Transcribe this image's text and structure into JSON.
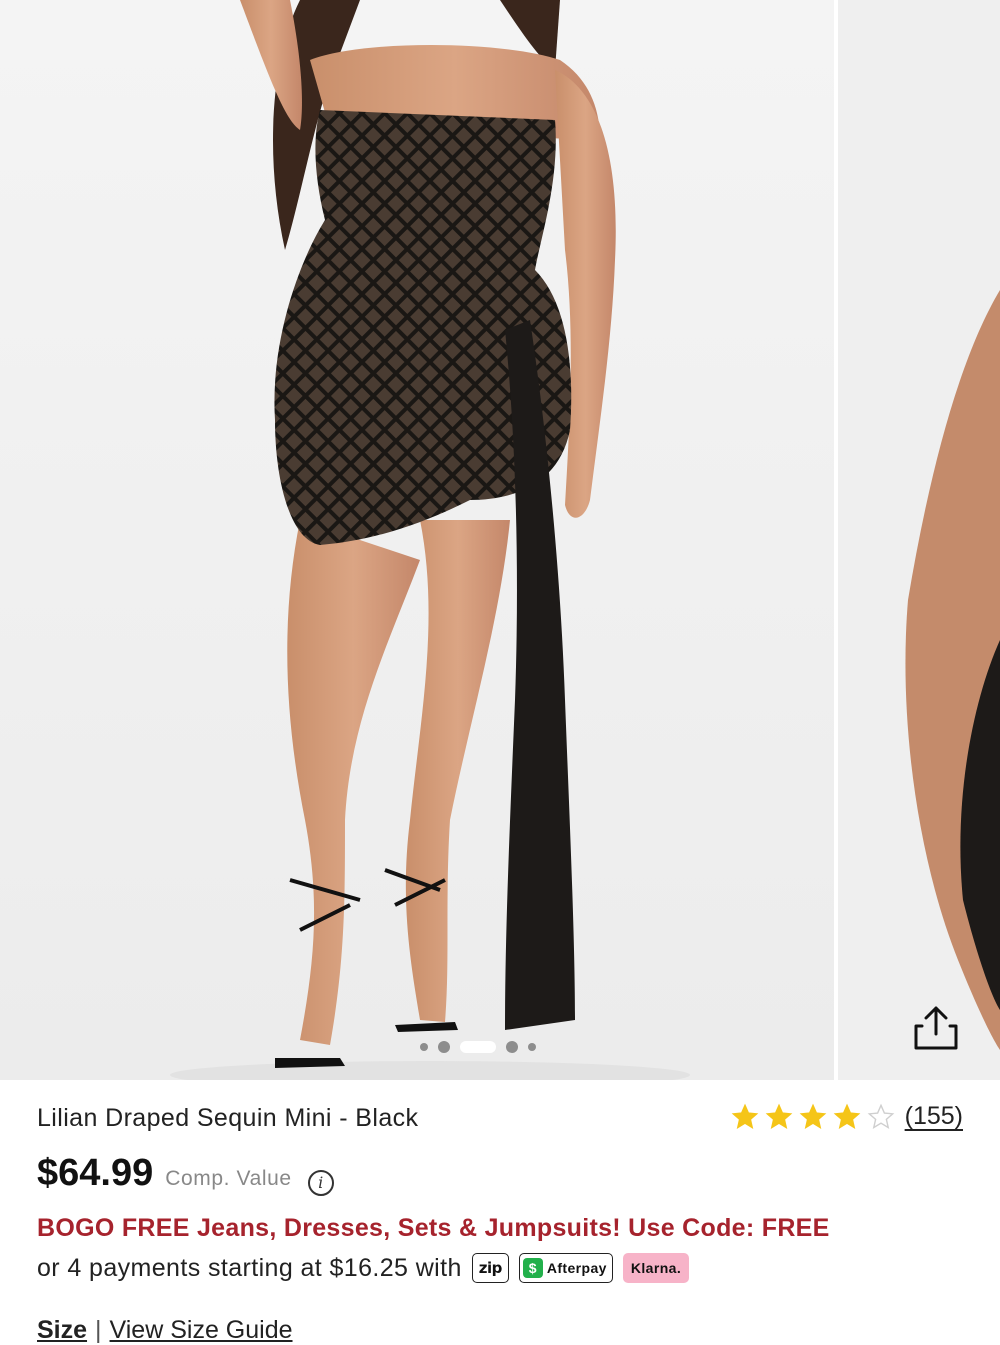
{
  "product": {
    "title": "Lilian Draped Sequin Mini - Black",
    "rating": {
      "stars_filled": 4,
      "stars_total": 5,
      "review_count": "(155)"
    },
    "price": "$64.99",
    "comp_value_label": "Comp. Value",
    "info_glyph": "i"
  },
  "promo": {
    "text": "BOGO FREE Jeans, Dresses, Sets & Jumpsuits! Use Code: FREE"
  },
  "payments": {
    "text": "or 4 payments starting at $16.25 with",
    "providers": {
      "zip": "zip",
      "afterpay": "Afterpay",
      "afterpay_glyph": "$",
      "klarna": "Klarna."
    }
  },
  "size": {
    "label": "Size",
    "separator": "|",
    "guide": "View Size Guide"
  },
  "gallery": {
    "total_images": 5,
    "active_index": 2,
    "share_icon": "share-icon"
  },
  "colors": {
    "promo": "#a6232d",
    "star": "#f5c518",
    "afterpay": "#22b04b",
    "klarna": "#f7b3c8"
  }
}
